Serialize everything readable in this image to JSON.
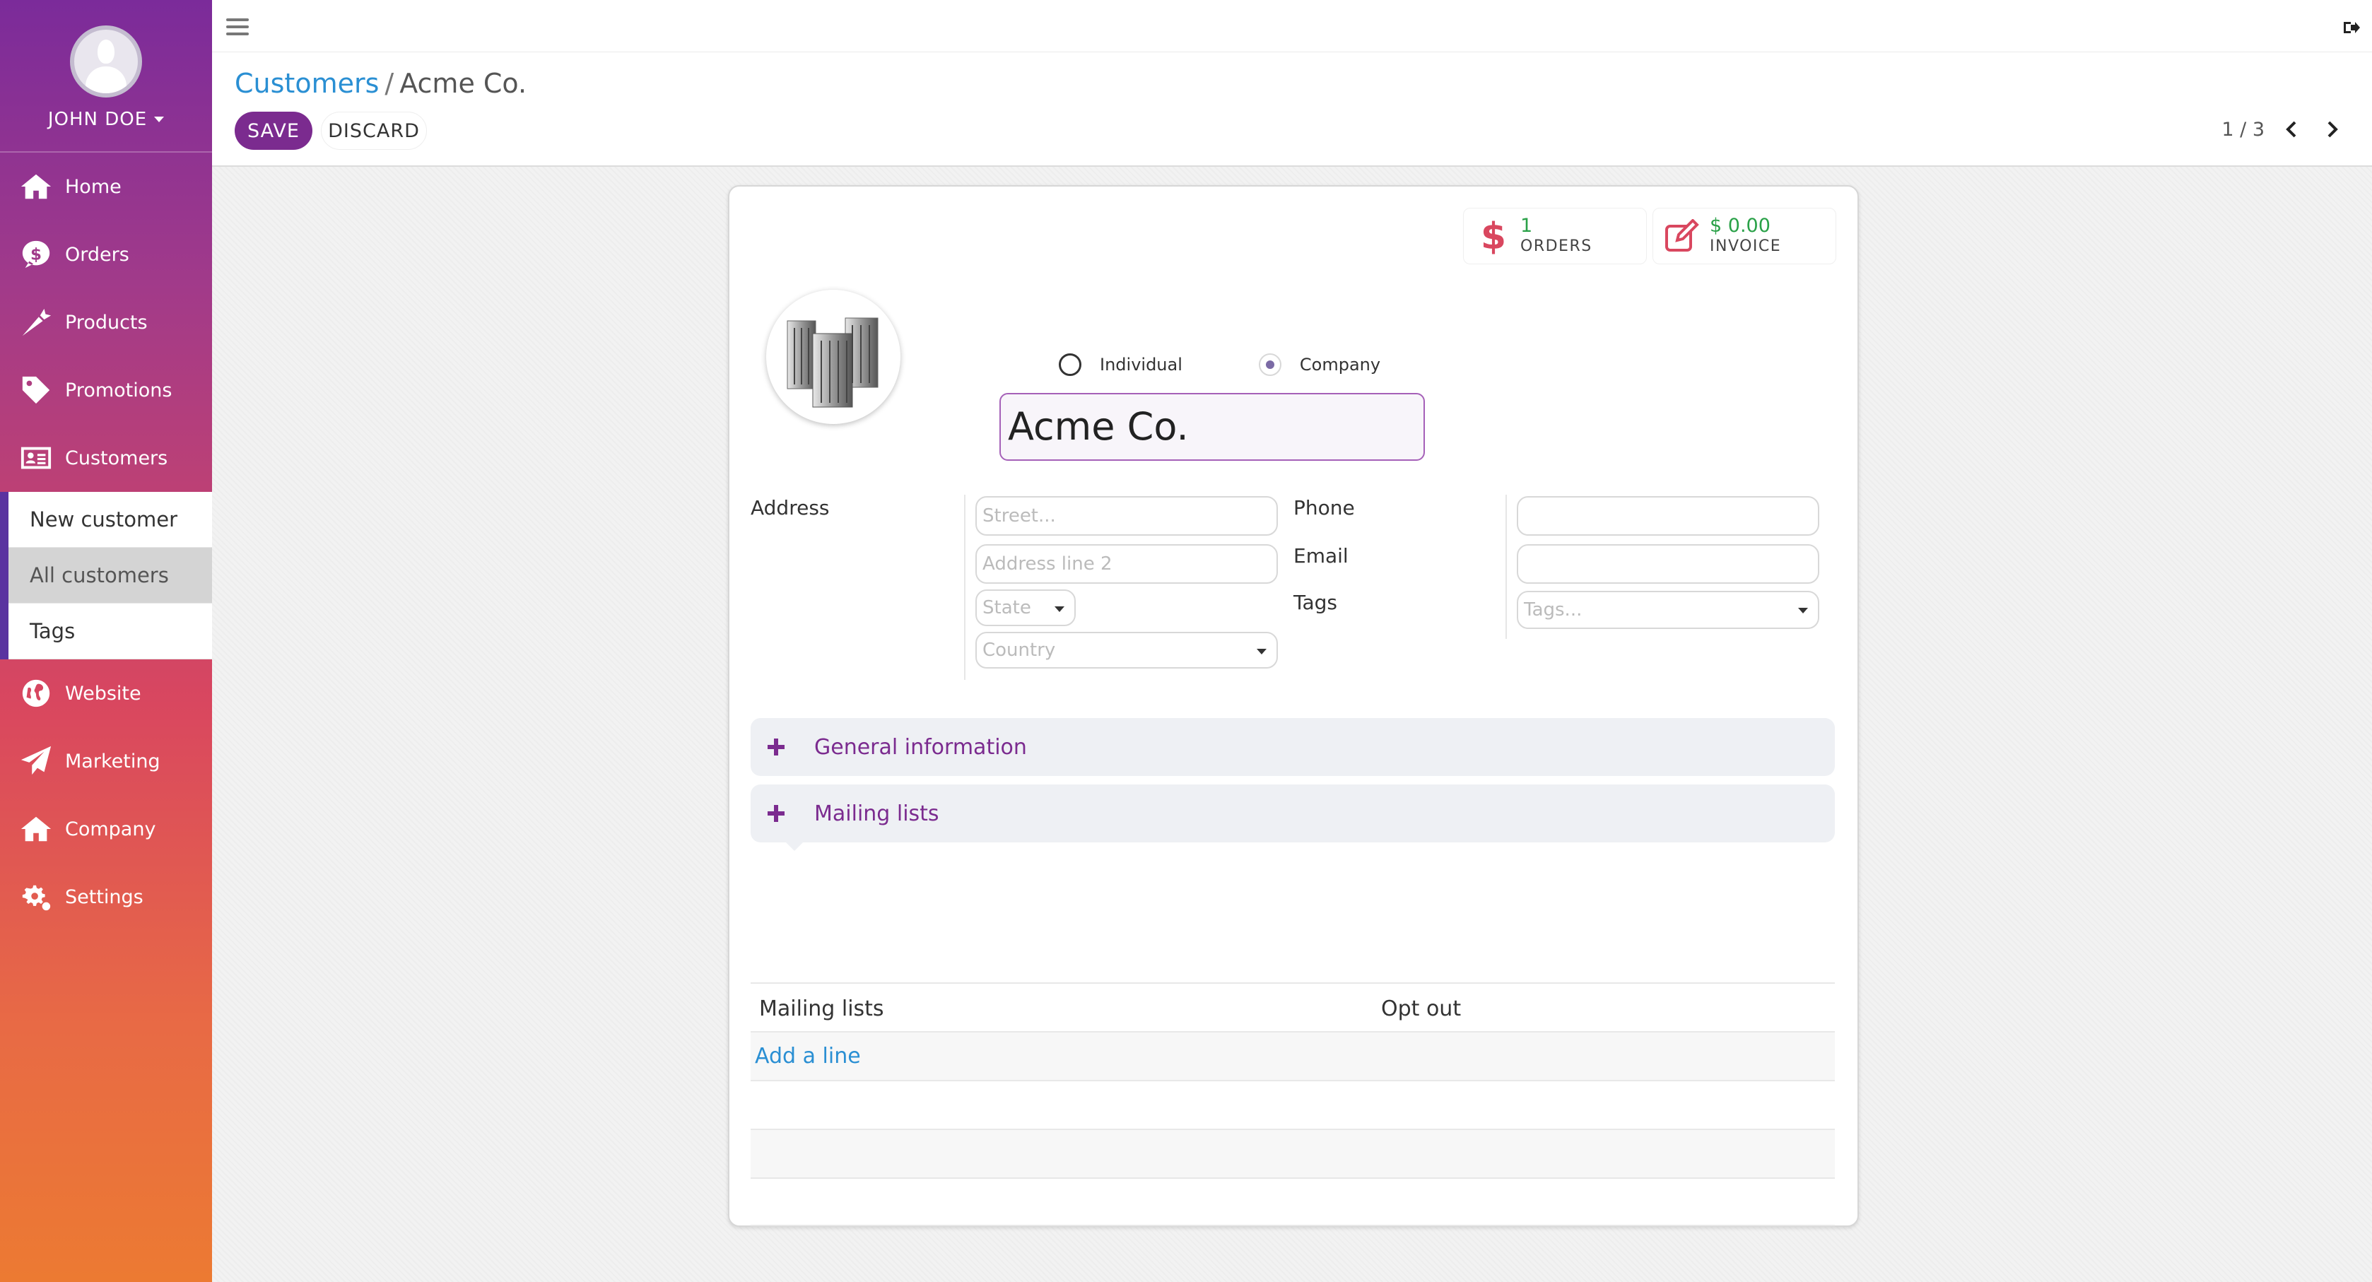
{
  "user": {
    "name": "JOHN DOE"
  },
  "nav": [
    {
      "label": "Home",
      "icon": "home-icon"
    },
    {
      "label": "Orders",
      "icon": "dollar-icon"
    },
    {
      "label": "Products",
      "icon": "carrot-icon"
    },
    {
      "label": "Promotions",
      "icon": "tag-icon"
    },
    {
      "label": "Customers",
      "icon": "address-card-icon"
    },
    {
      "label": "Website",
      "icon": "globe-icon"
    },
    {
      "label": "Marketing",
      "icon": "paper-plane-icon"
    },
    {
      "label": "Company",
      "icon": "building-home-icon"
    },
    {
      "label": "Settings",
      "icon": "gears-icon"
    }
  ],
  "customers_submenu": [
    {
      "label": "New customer",
      "active": false
    },
    {
      "label": "All customers",
      "active": true
    },
    {
      "label": "Tags",
      "active": false
    }
  ],
  "breadcrumb": {
    "parent": "Customers",
    "separator": "/",
    "current": "Acme Co."
  },
  "actions": {
    "save": "SAVE",
    "discard": "DISCARD"
  },
  "pager": {
    "value": "1 / 3"
  },
  "stats": {
    "orders": {
      "value": "1",
      "label": "ORDERS"
    },
    "invoice": {
      "value": "$ 0.00",
      "label": "INVOICE"
    }
  },
  "type_options": {
    "individual": "Individual",
    "company": "Company",
    "selected": "Company"
  },
  "customer": {
    "name": "Acme Co."
  },
  "address": {
    "label": "Address",
    "street_placeholder": "Street...",
    "line2_placeholder": "Address line 2",
    "state_placeholder": "State",
    "country_placeholder": "Country"
  },
  "contact": {
    "phone_label": "Phone",
    "email_label": "Email",
    "tags_label": "Tags",
    "tags_placeholder": "Tags..."
  },
  "panels": {
    "general": "General information",
    "mailing": "Mailing lists"
  },
  "table": {
    "columns": [
      "Mailing lists",
      "Opt out"
    ],
    "add_line": "Add a line"
  },
  "colors": {
    "brand_purple": "#7b2b8f",
    "link_blue": "#2a8fd3",
    "success_green": "#2aa148"
  }
}
